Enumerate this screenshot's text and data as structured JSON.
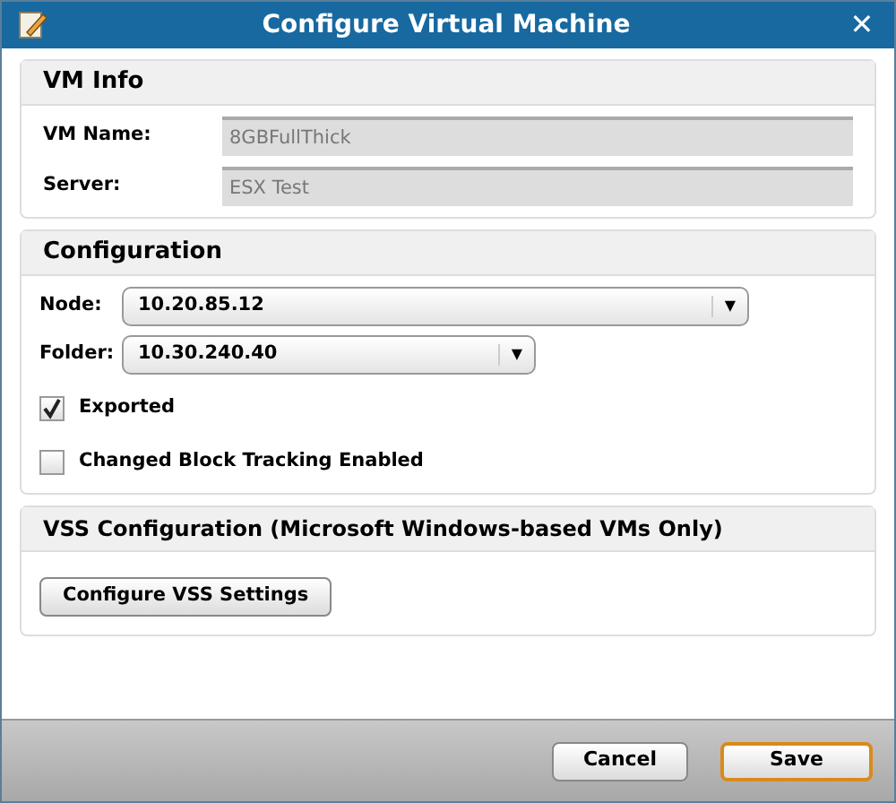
{
  "window": {
    "title": "Configure Virtual Machine",
    "close": "✕"
  },
  "vm_info": {
    "title": "VM Info",
    "fields": [
      {
        "label": "VM Name:",
        "value": "8GBFullThick",
        "disabled": true
      },
      {
        "label": "Server:",
        "value": "ESX Test",
        "disabled": true
      }
    ]
  },
  "configuration": {
    "title": "Configuration",
    "selects": [
      {
        "label": "Node:",
        "value": "10.20.85.12",
        "arrow": "▼",
        "wide": true
      },
      {
        "label": "Folder:",
        "value": "10.30.240.40",
        "arrow": "▼",
        "wide": false
      }
    ],
    "checkboxes": [
      {
        "label": "Exported",
        "checked": true
      },
      {
        "label": "Changed Block Tracking Enabled",
        "checked": false
      }
    ]
  },
  "vss": {
    "title": "VSS Configuration (Microsoft Windows-based VMs Only)",
    "button": "Configure VSS Settings"
  },
  "buttons": [
    {
      "label": "Cancel",
      "focused": false
    },
    {
      "label": "Save",
      "focused": true
    }
  ]
}
